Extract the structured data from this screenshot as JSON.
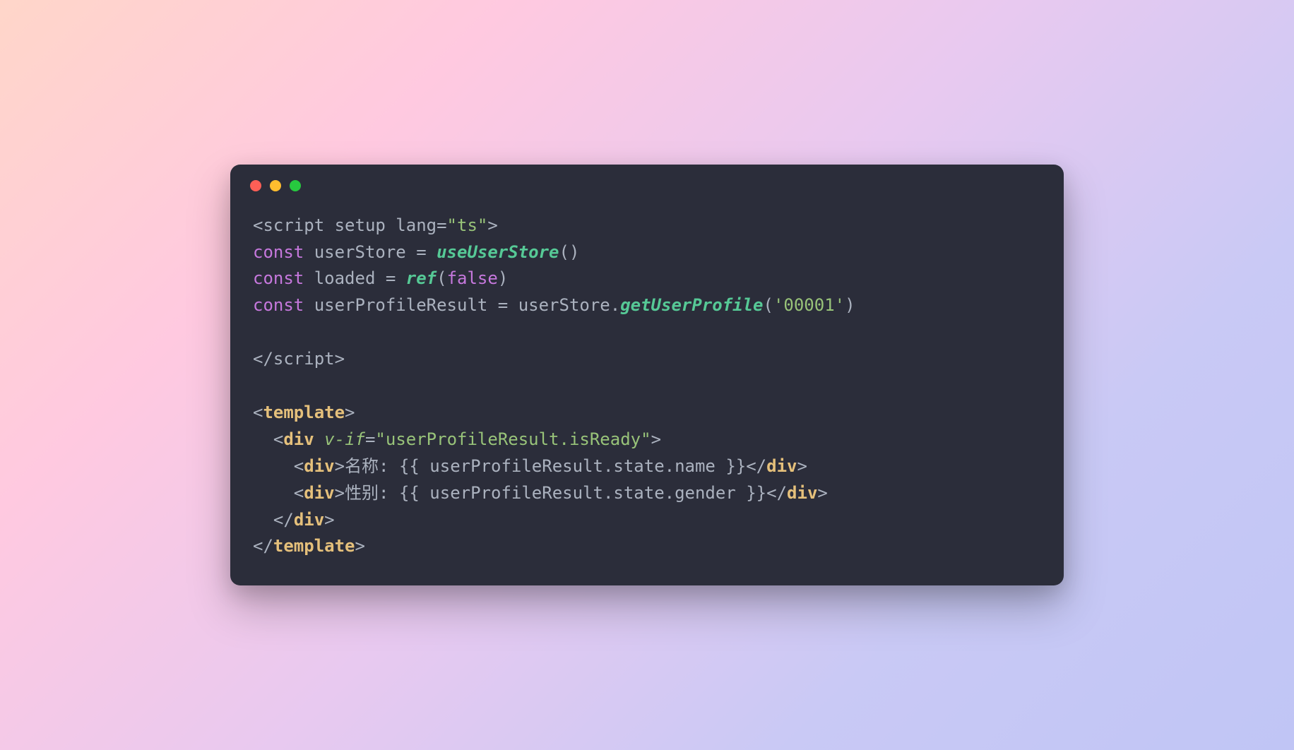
{
  "code": {
    "l1": {
      "p1": "<",
      "p2": "script setup lang",
      "p3": "=",
      "p4": "\"ts\"",
      "p5": ">"
    },
    "l2": {
      "p1": "const",
      "p2": " userStore ",
      "p3": "=",
      "p4": " ",
      "p5": "useUserStore",
      "p6": "()"
    },
    "l3": {
      "p1": "const",
      "p2": " loaded ",
      "p3": "=",
      "p4": " ",
      "p5": "ref",
      "p6": "(",
      "p7": "false",
      "p8": ")"
    },
    "l4": {
      "p1": "const",
      "p2": " userProfileResult ",
      "p3": "=",
      "p4": " userStore.",
      "p5": "getUserProfile",
      "p6": "(",
      "p7": "'00001'",
      "p8": ")"
    },
    "l5": "",
    "l6": {
      "p1": "</",
      "p2": "script",
      "p3": ">"
    },
    "l7": "",
    "l8": {
      "p1": "<",
      "p2": "template",
      "p3": ">"
    },
    "l9": {
      "indent": "  ",
      "p1": "<",
      "p2": "div",
      "p3": " ",
      "p4": "v-if",
      "p5": "=",
      "p6": "\"userProfileResult.isReady\"",
      "p7": ">"
    },
    "l10": {
      "indent": "    ",
      "p1": "<",
      "p2": "div",
      "p3": ">",
      "p4": "名称: {{ userProfileResult.state.name }}",
      "p5": "</",
      "p6": "div",
      "p7": ">"
    },
    "l11": {
      "indent": "    ",
      "p1": "<",
      "p2": "div",
      "p3": ">",
      "p4": "性别: {{ userProfileResult.state.gender }}",
      "p5": "</",
      "p6": "div",
      "p7": ">"
    },
    "l12": {
      "indent": "  ",
      "p1": "</",
      "p2": "div",
      "p3": ">"
    },
    "l13": {
      "p1": "</",
      "p2": "template",
      "p3": ">"
    }
  },
  "colors": {
    "window_bg": "#2b2d3a",
    "dot_red": "#ff5f56",
    "dot_yellow": "#ffbd2e",
    "dot_green": "#27c93f"
  }
}
